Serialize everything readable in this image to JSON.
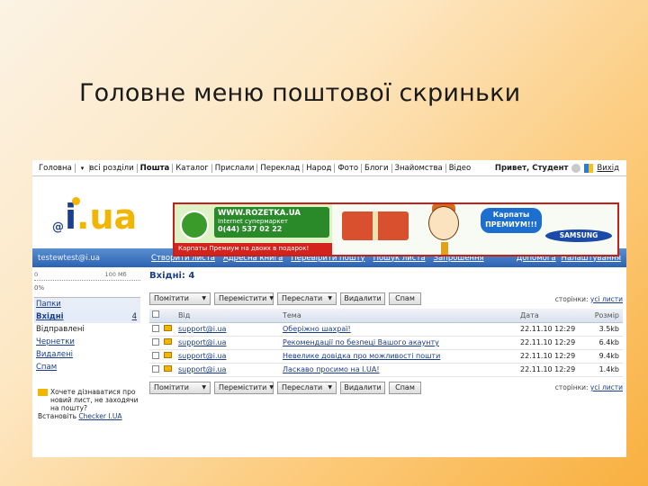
{
  "slide": {
    "title": "Головне  меню поштової скриньки"
  },
  "topnav": {
    "links": [
      "Головна",
      "всі розділи",
      "Пошта",
      "Каталог",
      "Прислали",
      "Переклад",
      "Народ",
      "Фото",
      "Блоги",
      "Знайомства",
      "Відео"
    ],
    "greeting": "Привет, Студент",
    "logout": "Вихід"
  },
  "banner": {
    "url": "WWW.ROZETKA.UA",
    "sub": "Internet супермаркет",
    "phone": "0(44) 537 02 22",
    "bubble": "Карпаты ПРЕМИУМ!!!",
    "brand": "SAMSUNG",
    "strip": "Карпаты Премиум на двоих в подарок!"
  },
  "bluebar": {
    "email": "testewtest@i.ua",
    "actions": [
      "Створити листа",
      "Адресна книга",
      "Перевірити пошту",
      "Пошук листа",
      "Запрошення"
    ],
    "help": [
      "Допомога",
      "Налаштування"
    ]
  },
  "sidebar": {
    "quota_label": "0                                    100 Мб",
    "quota_pct": "0%",
    "folders_header": "Папки",
    "folders": [
      {
        "name": "Вхідні",
        "count": "4"
      },
      {
        "name": "Відправлені",
        "count": ""
      },
      {
        "name": "Чернетки",
        "count": ""
      },
      {
        "name": "Видалені",
        "count": ""
      },
      {
        "name": "Спам",
        "count": ""
      }
    ],
    "promo_line1": "Хочете дізнаватися про",
    "promo_line2": "новий лист, не заходячи",
    "promo_line3": "на пошту?",
    "promo_line4": "Встановіть",
    "promo_link": "Checker I.UA"
  },
  "main": {
    "inbox_title": "Вхідні: 4",
    "toolbar": {
      "mark": "Помітити",
      "move": "Перемістити",
      "forward": "Переслати",
      "delete": "Видалити",
      "spam": "Спам",
      "pages_label": "сторінки:",
      "pages_value": "усі листи"
    },
    "columns": {
      "from": "Від",
      "subject": "Тема",
      "date": "Дата",
      "size": "Розмір"
    },
    "messages": [
      {
        "from": "support@i.ua",
        "subject": "Оберіжно шахраї!",
        "date": "22.11.10 12:29",
        "size": "3.5kb"
      },
      {
        "from": "support@i.ua",
        "subject": "Рекомендації по безпеці Вашого акаунту",
        "date": "22.11.10 12:29",
        "size": "6.4kb"
      },
      {
        "from": "support@i.ua",
        "subject": "Невелике довідка про можливості пошти",
        "date": "22.11.10 12:29",
        "size": "9.4kb"
      },
      {
        "from": "support@i.ua",
        "subject": "Ласкаво просимо на I.UA!",
        "date": "22.11.10 12:29",
        "size": "1.4kb"
      }
    ]
  }
}
